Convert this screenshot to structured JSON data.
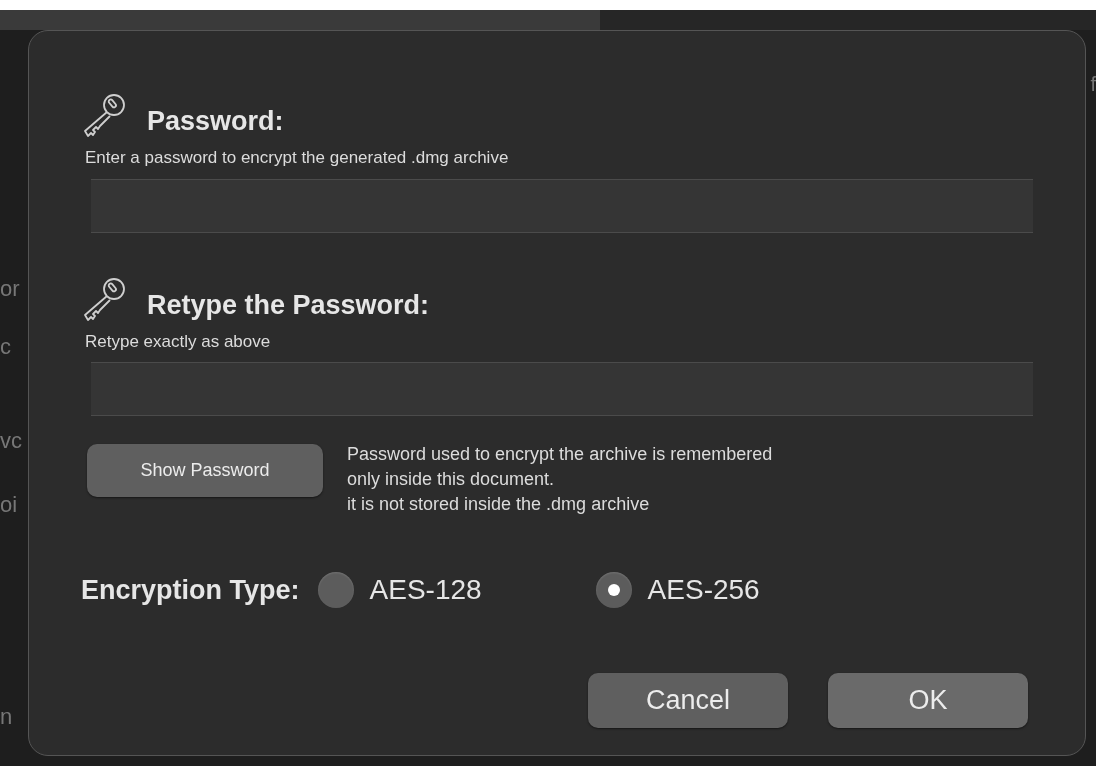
{
  "background": {
    "left_fragments": [
      "or",
      "c",
      "vc",
      "oi",
      "n"
    ],
    "right_fragments": [
      "f"
    ]
  },
  "dialog": {
    "password": {
      "title": "Password:",
      "hint": "Enter a password to encrypt the generated .dmg archive"
    },
    "retype": {
      "title": "Retype the Password:",
      "hint": "Retype exactly as above"
    },
    "show_password_button": "Show Password",
    "note": [
      "Password used to encrypt the archive is remembered",
      "only inside this document.",
      "it is not stored inside the .dmg archive"
    ],
    "encryption": {
      "label": "Encryption Type:",
      "options": [
        {
          "label": "AES-128",
          "selected": false
        },
        {
          "label": "AES-256",
          "selected": true
        }
      ]
    },
    "buttons": [
      {
        "label": "Cancel",
        "kind": "cancel"
      },
      {
        "label": "OK",
        "kind": "ok"
      }
    ]
  }
}
